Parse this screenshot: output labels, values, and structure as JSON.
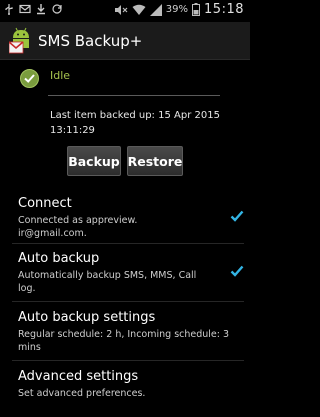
{
  "status_bar": {
    "battery_percent": "39%",
    "time": "15:18"
  },
  "action_bar": {
    "title": "SMS Backup+"
  },
  "status": {
    "state": "Idle",
    "last_backup": "Last item backed up: 15 Apr 2015 13:11:29"
  },
  "buttons": {
    "backup": "Backup",
    "restore": "Restore"
  },
  "settings": [
    {
      "title": "Connect",
      "summary": "Connected as appreview. ir@gmail.com.",
      "checked": true
    },
    {
      "title": "Auto backup",
      "summary": "Automatically backup SMS, MMS, Call log.",
      "checked": true
    },
    {
      "title": "Auto backup settings",
      "summary": "Regular schedule: 2 h, Incoming schedule: 3 mins"
    },
    {
      "title": "Advanced settings",
      "summary": "Set advanced preferences."
    }
  ],
  "colors": {
    "accent": "#33b5e5",
    "status_ok": "#a6c34e"
  }
}
